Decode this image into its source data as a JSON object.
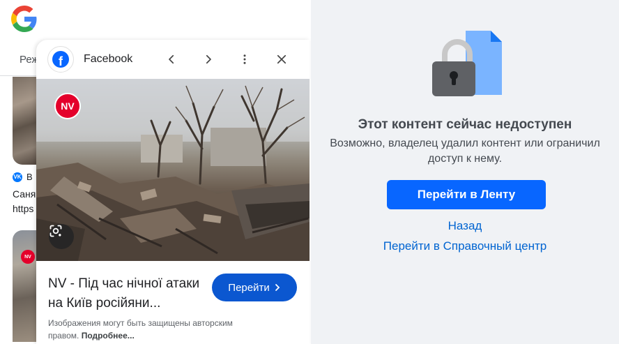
{
  "background": {
    "tab_label": "Реж",
    "result_source": "В",
    "result_line1": "Саня",
    "result_line2": "https"
  },
  "preview": {
    "site_name": "Facebook",
    "image_badge": "NV",
    "title": "NV - Під час нічної атаки на Київ російяни...",
    "visit_label": "Перейти",
    "copyright_text": "Изображения могут быть защищены авторским правом.",
    "copyright_more": "Подробнее..."
  },
  "facebook": {
    "title": "Этот контент сейчас недоступен",
    "description": "Возможно, владелец удалил контент или ограничил доступ к нему.",
    "feed_button": "Перейти в Ленту",
    "back_link": "Назад",
    "help_link": "Перейти в Справочный центр"
  },
  "icons": {
    "google": "google-logo-icon",
    "facebook": "facebook-logo-icon",
    "prev": "chevron-left-icon",
    "next": "chevron-right-icon",
    "more": "more-vert-icon",
    "close": "close-icon",
    "lens": "google-lens-icon",
    "lock": "lock-document-icon"
  },
  "colors": {
    "google_blue_button": "#0b57d0",
    "facebook_blue": "#0866ff",
    "facebook_link": "#0064d1",
    "facebook_bg": "#f0f2f5",
    "nv_red": "#e4002b"
  }
}
